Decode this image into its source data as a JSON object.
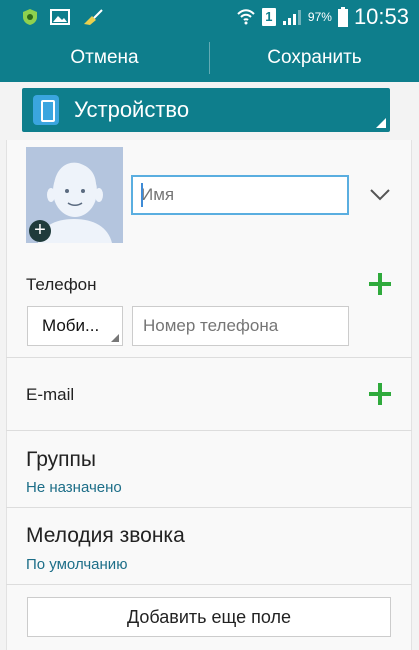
{
  "statusbar": {
    "battery_percent": "97%",
    "time": "10:53",
    "sim_label": "1",
    "icons": [
      "shield-app-icon",
      "image-icon",
      "broom-icon",
      "wifi-icon",
      "sim-icon",
      "signal-icon",
      "battery-icon"
    ]
  },
  "actionbar": {
    "cancel_label": "Отмена",
    "save_label": "Сохранить"
  },
  "account": {
    "label": "Устройство",
    "icon": "phone-device-icon"
  },
  "name": {
    "placeholder": "Имя"
  },
  "phone": {
    "section_label": "Телефон",
    "type_value": "Моби...",
    "placeholder": "Номер телефона"
  },
  "email": {
    "section_label": "E-mail"
  },
  "groups": {
    "title": "Группы",
    "value": "Не назначено"
  },
  "ringtone": {
    "title": "Мелодия звонка",
    "value": "По умолчанию"
  },
  "add_field_label": "Добавить еще поле",
  "colors": {
    "accent": "#0e7e8c",
    "plus": "#2faa3c",
    "focus": "#5aaee0"
  }
}
